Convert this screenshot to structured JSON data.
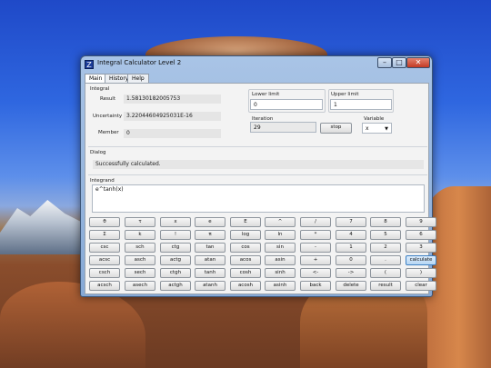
{
  "window": {
    "title": "Integral Calculator Level 2",
    "icon_letter": "Z"
  },
  "controls": {
    "minimize": "–",
    "maximize": "□",
    "close": "✕"
  },
  "tabs": [
    "Main",
    "History",
    "Help"
  ],
  "result": {
    "result_label": "Result",
    "result_value": "1.58130182005753",
    "uncertainty_label": "Uncertainty",
    "uncertainty_value": "3.22044604925031E-16",
    "member_label": "Member",
    "member_value": "0",
    "integral_label": "Integral"
  },
  "limits": {
    "lower_label": "Lower limit",
    "lower_value": "0",
    "upper_label": "Upper limit",
    "upper_value": "1",
    "iteration_label": "Iteration",
    "iteration_value": "29",
    "stop_label": "stop",
    "variable_label": "Variable",
    "variable_value": "x"
  },
  "dialog": {
    "label": "Dialog",
    "message": "Successfully calculated."
  },
  "integrand": {
    "label": "Integrand",
    "value": "e^tanh(x)"
  },
  "keypad": [
    [
      "θ",
      "τ",
      "x",
      "e",
      "E",
      "^",
      "/",
      "7",
      "8",
      "9"
    ],
    [
      "Σ",
      "k",
      "!",
      "π",
      "log",
      "ln",
      "*",
      "4",
      "5",
      "6"
    ],
    [
      "csc",
      "sch",
      "ctg",
      "tan",
      "cos",
      "sin",
      "-",
      "1",
      "2",
      "3"
    ],
    [
      "acsc",
      "asch",
      "actg",
      "atan",
      "acos",
      "asin",
      "+",
      "0",
      ".",
      "calculate"
    ],
    [
      "csch",
      "sech",
      "ctgh",
      "tanh",
      "cosh",
      "sinh",
      "<-",
      "->",
      "(",
      ")"
    ],
    [
      "acsch",
      "asech",
      "actgh",
      "atanh",
      "acosh",
      "asinh",
      "back",
      "delete",
      "result",
      "clear"
    ]
  ],
  "colors": {
    "accent_button": "#b7d6f3",
    "window_frame": "#86a9d6",
    "close_button": "#c33a24"
  }
}
